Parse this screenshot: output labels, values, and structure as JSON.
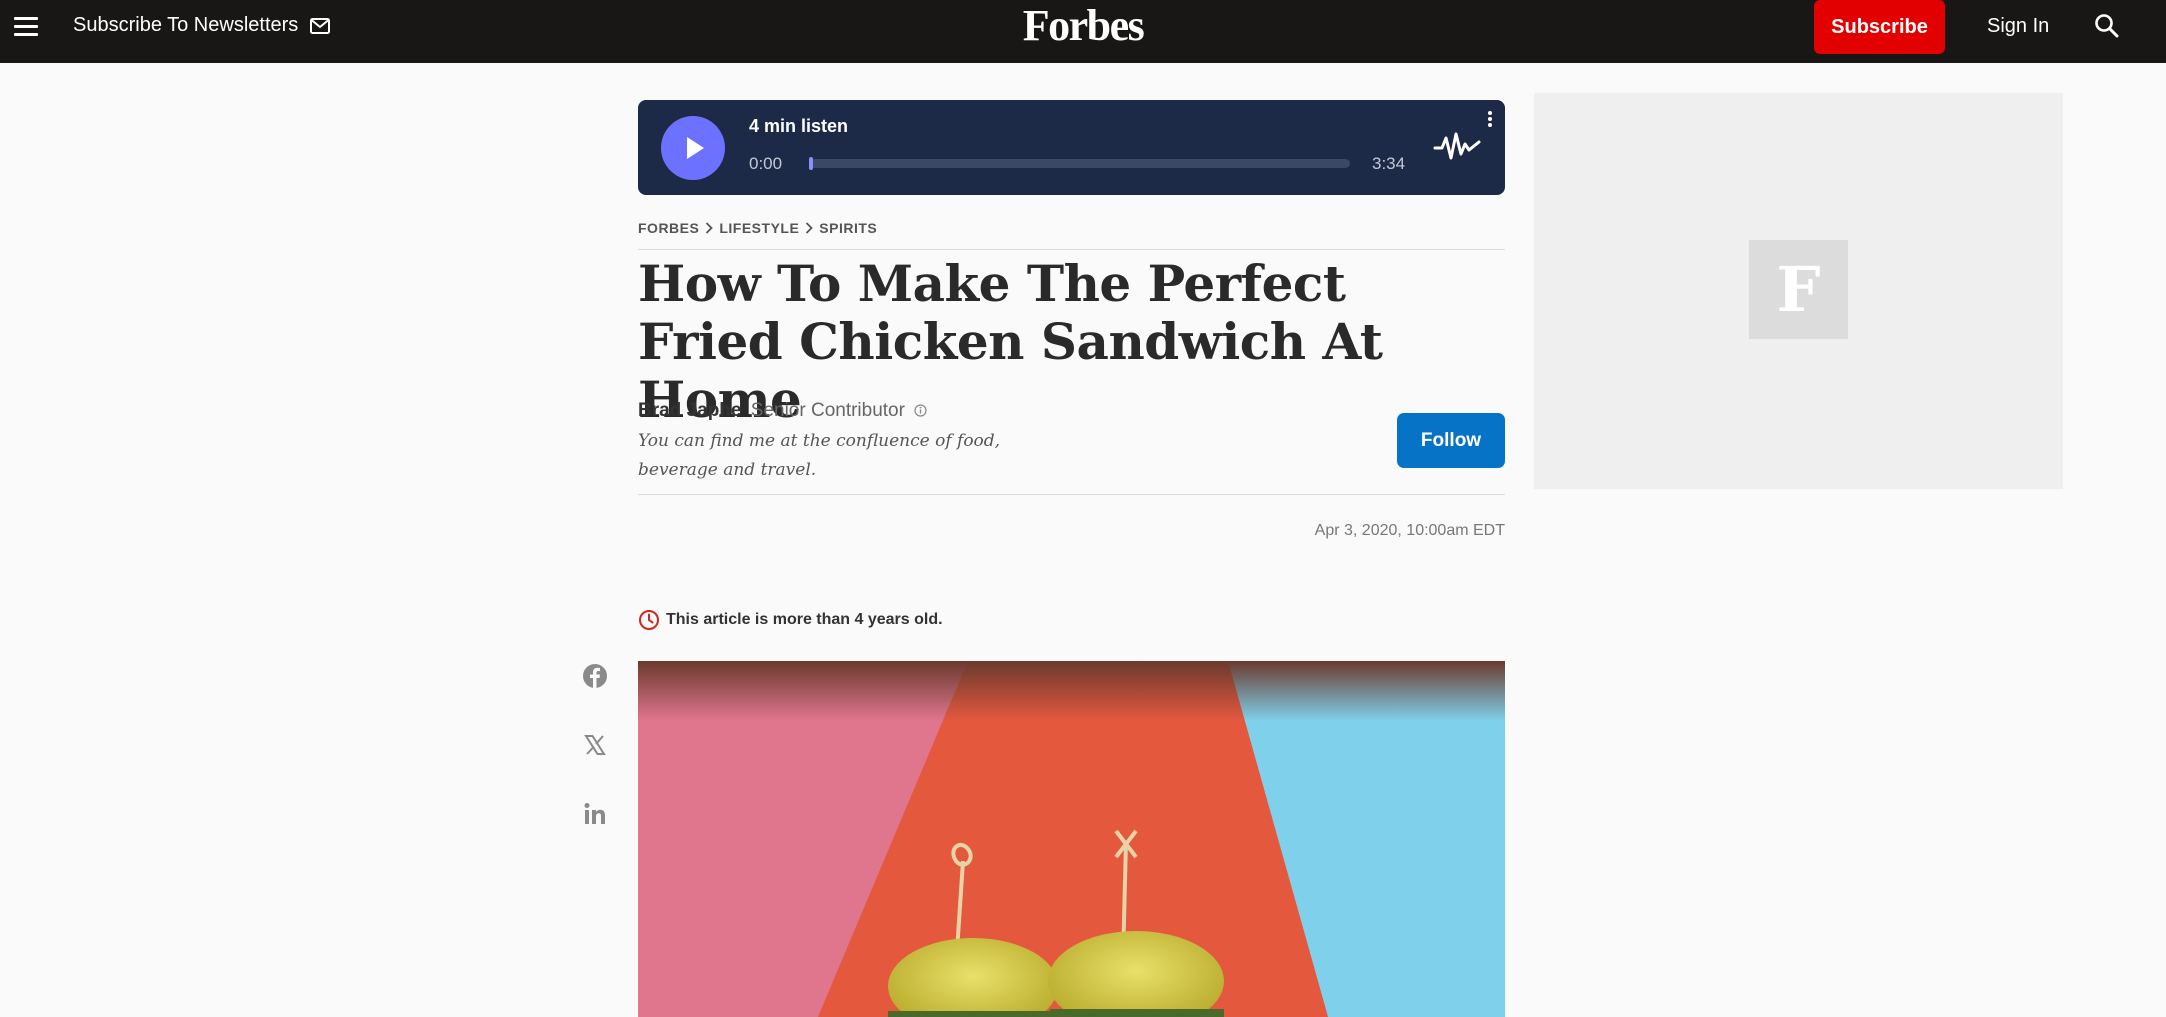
{
  "header": {
    "menu_icon": "hamburger-menu-icon",
    "newsletter_label": "Subscribe To Newsletters",
    "newsletter_icon": "mail-icon",
    "logo_text": "Forbes",
    "subscribe_label": "Subscribe",
    "signin_label": "Sign In",
    "search_icon": "search-icon"
  },
  "player": {
    "listen_label": "4 min listen",
    "current_time": "0:00",
    "total_time": "3:34",
    "progress": 0,
    "accent_color": "#6c72ff",
    "background_color": "#1c2a47"
  },
  "breadcrumb": [
    {
      "label": "FORBES"
    },
    {
      "label": "LIFESTYLE"
    },
    {
      "label": "SPIRITS"
    }
  ],
  "article": {
    "headline": "How To Make The Perfect Fried Chicken Sandwich At Home",
    "author_name": "Brad Japhe",
    "author_role": "Senior Contributor",
    "author_bio": "You can find me at the confluence of food, beverage and travel.",
    "follow_label": "Follow",
    "published": "Apr 3, 2020, 10:00am EDT",
    "age_notice": "This article is more than 4 years old."
  },
  "share": [
    {
      "icon": "facebook-icon"
    },
    {
      "icon": "x-twitter-icon"
    },
    {
      "icon": "linkedin-icon"
    }
  ],
  "ad": {
    "logo_letter": "F"
  },
  "colors": {
    "topbar": "#181716",
    "subscribe": "#e30000",
    "follow": "#0773c6"
  }
}
